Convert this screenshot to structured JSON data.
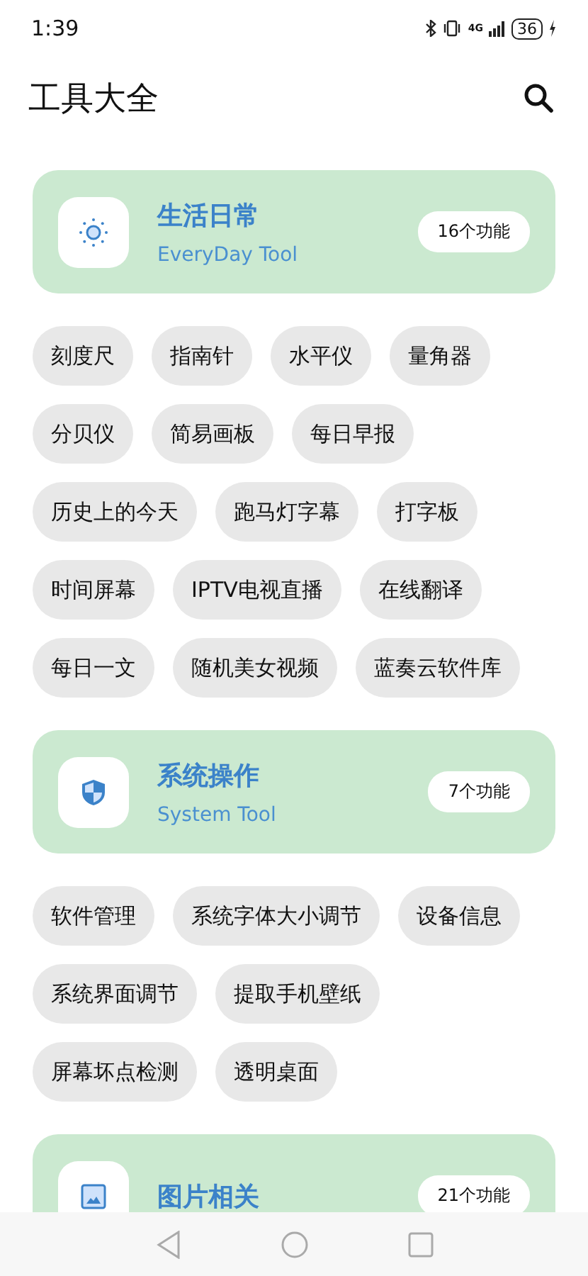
{
  "status_bar": {
    "time": "1:39",
    "network": "4G",
    "battery": "36"
  },
  "header": {
    "title": "工具大全"
  },
  "sections": [
    {
      "title": "生活日常",
      "subtitle": "EveryDay Tool",
      "count": "16个功能",
      "tools": [
        "刻度尺",
        "指南针",
        "水平仪",
        "量角器",
        "分贝仪",
        "简易画板",
        "每日早报",
        "历史上的今天",
        "跑马灯字幕",
        "打字板",
        "时间屏幕",
        "IPTV电视直播",
        "在线翻译",
        "每日一文",
        "随机美女视频",
        "蓝奏云软件库"
      ]
    },
    {
      "title": "系统操作",
      "subtitle": "System Tool",
      "count": "7个功能",
      "tools": [
        "软件管理",
        "系统字体大小调节",
        "设备信息",
        "系统界面调节",
        "提取手机壁纸",
        "屏幕坏点检测",
        "透明桌面"
      ]
    },
    {
      "title": "图片相关",
      "count": "21个功能"
    }
  ]
}
